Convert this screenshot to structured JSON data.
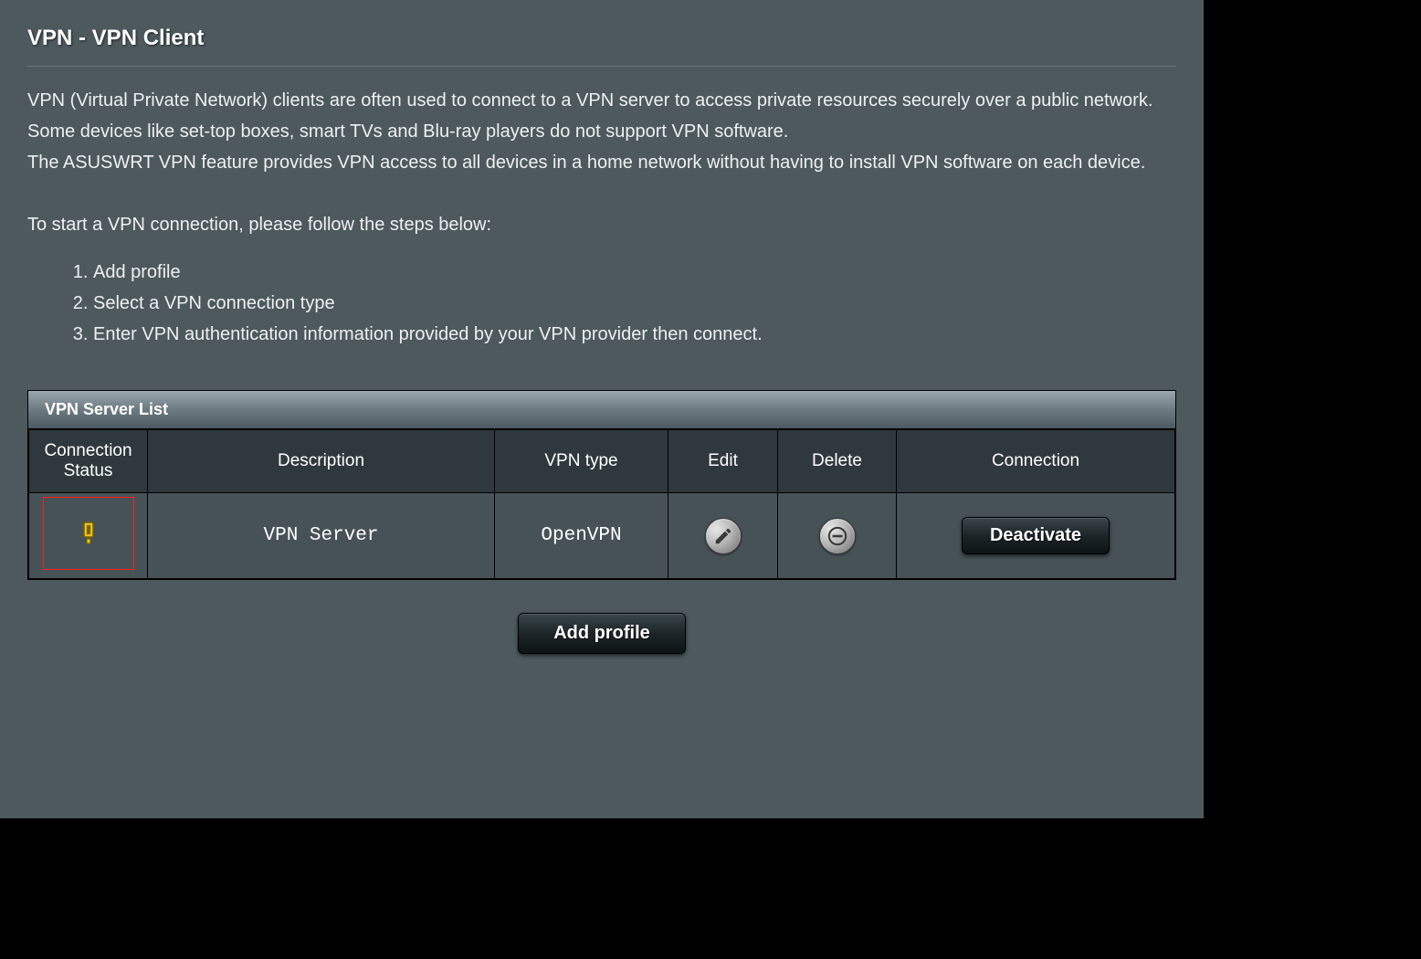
{
  "header": {
    "title": "VPN - VPN Client"
  },
  "intro": {
    "p1": "VPN (Virtual Private Network) clients are often used to connect to a VPN server to access private resources securely over a public network.",
    "p2": "Some devices like set-top boxes, smart TVs and Blu-ray players do not support VPN software.",
    "p3": "The ASUSWRT VPN feature provides VPN access to all devices in a home network without having to install VPN software on each device.",
    "p4": "To start a VPN connection, please follow the steps below:"
  },
  "steps": [
    "Add profile",
    "Select a VPN connection type",
    "Enter VPN authentication information provided by your VPN provider then connect."
  ],
  "table": {
    "caption": "VPN Server List",
    "columns": {
      "status": "Connection Status",
      "description": "Description",
      "vpn_type": "VPN type",
      "edit": "Edit",
      "delete": "Delete",
      "connection": "Connection"
    },
    "rows": [
      {
        "status_icon": "warning",
        "description": "VPN Server",
        "vpn_type": "OpenVPN",
        "connection_action": "Deactivate"
      }
    ]
  },
  "buttons": {
    "add_profile": "Add profile"
  }
}
